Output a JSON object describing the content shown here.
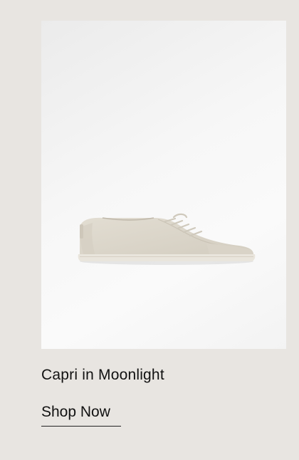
{
  "product": {
    "name": "Capri in Moonlight",
    "image_icon": "sneaker-image",
    "shoe_color": "#dcd7cc"
  },
  "cta": {
    "label": "Shop Now"
  },
  "colors": {
    "page_background": "#e8e5e1",
    "image_background": "#f5f5f5",
    "text": "#111111"
  }
}
